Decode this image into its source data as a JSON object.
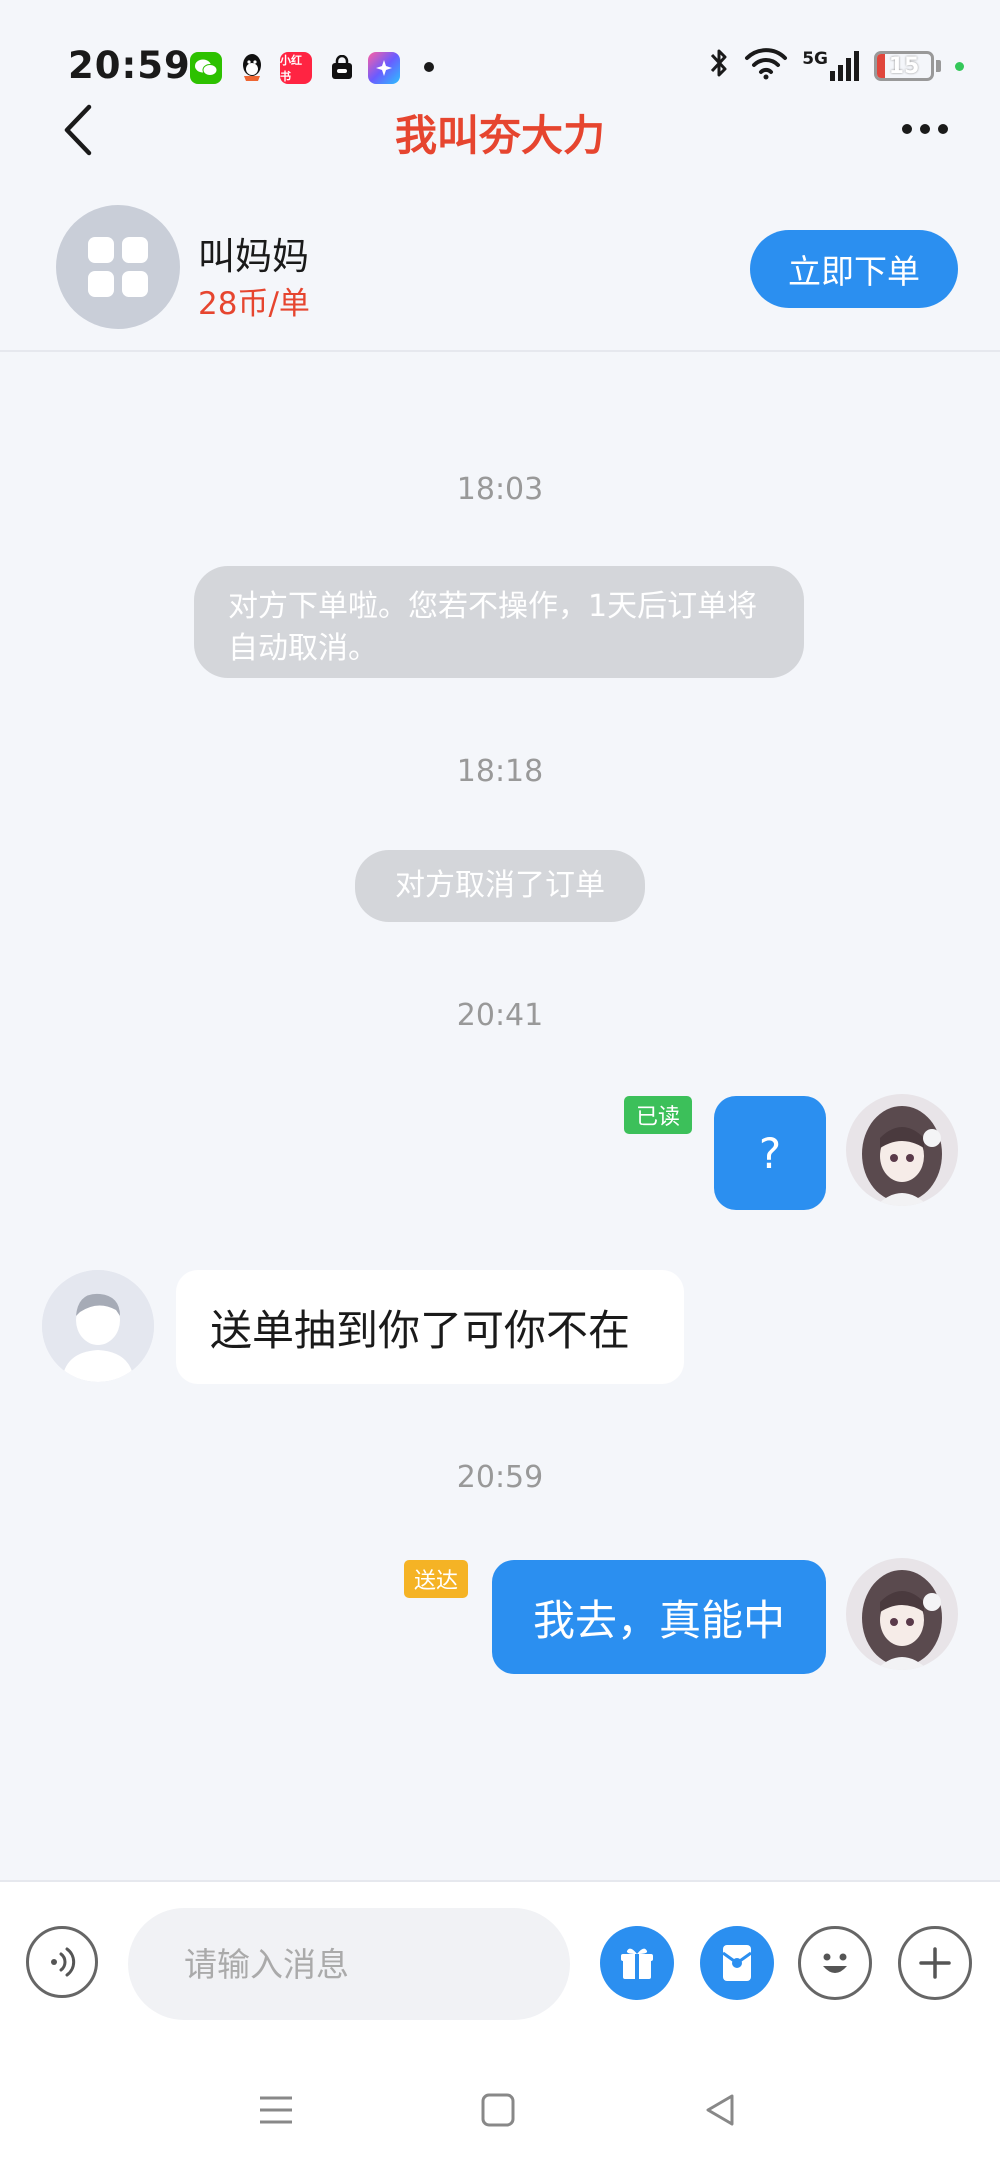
{
  "status_bar": {
    "time": "20:59",
    "apps": [
      {
        "icon": "wechat-icon",
        "color": "#2dc100"
      },
      {
        "icon": "qq-icon",
        "color": "#ffffff"
      },
      {
        "icon": "xiaohongshu-icon",
        "label": "小红书",
        "color": "#ff2442"
      },
      {
        "icon": "shopping-bag-icon",
        "color": "#ffffff"
      },
      {
        "icon": "app-colorful-icon",
        "color": "#6a5cff"
      }
    ],
    "network": "5G",
    "battery": "15"
  },
  "nav": {
    "title": "我叫夯大力"
  },
  "service": {
    "name": "叫妈妈",
    "price": "28币/单",
    "order_button": "立即下单"
  },
  "messages": {
    "ts1": "18:03",
    "sys1": "对方下单啦。您若不操作，1天后订单将自动取消。",
    "ts2": "18:18",
    "sys2": "对方取消了订单",
    "ts3": "20:41",
    "out1": {
      "text": "?",
      "status": "已读"
    },
    "in1": {
      "text": "送单抽到你了可你不在"
    },
    "ts4": "20:59",
    "out2": {
      "text": "我去，真能中",
      "status": "送达"
    }
  },
  "input": {
    "placeholder": "请输入消息"
  },
  "colors": {
    "accent": "#2b8ff0",
    "title_red": "#e6452f",
    "read_badge": "#3cc05a",
    "delivered_badge": "#f5b325"
  }
}
